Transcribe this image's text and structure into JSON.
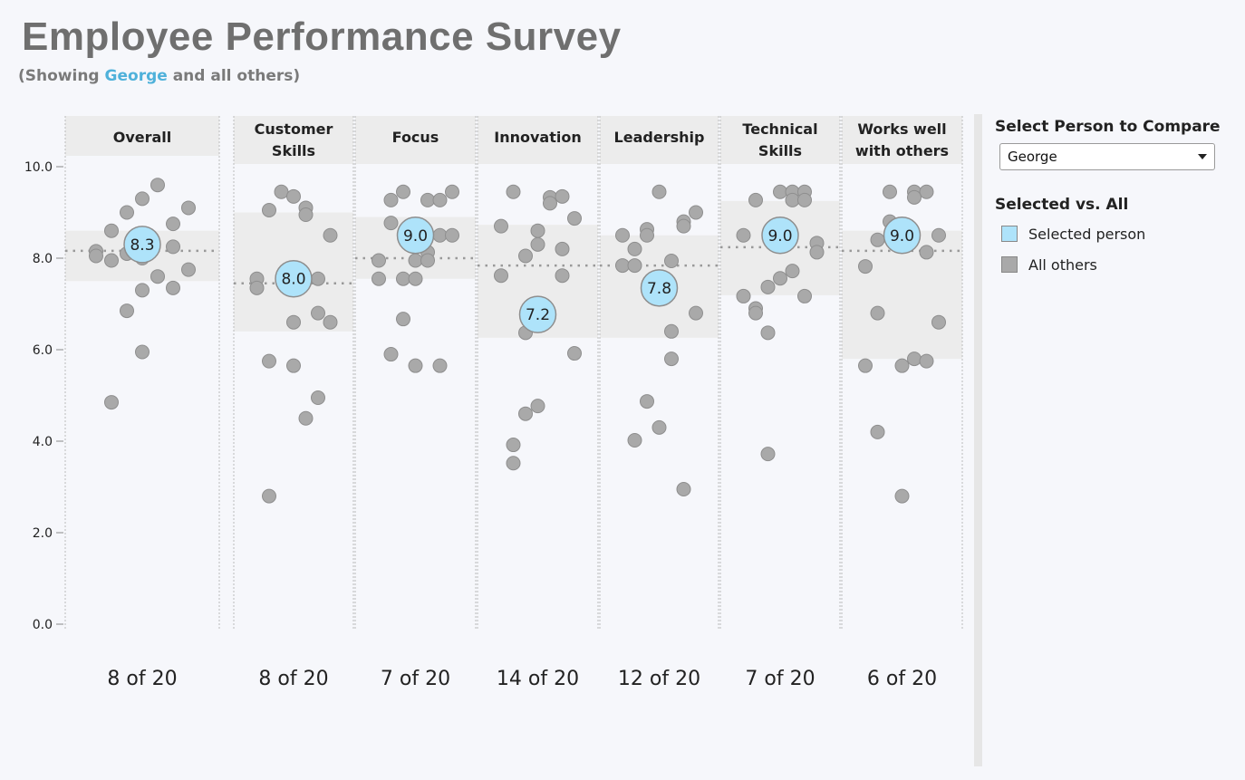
{
  "header": {
    "title": "Employee Performance Survey",
    "subtitle_prefix": "(Showing ",
    "subtitle_name": "George",
    "subtitle_suffix": " and all others)"
  },
  "panel": {
    "select_label": "Select Person to Compare",
    "selected_value": "George",
    "legend_title": "Selected vs. All",
    "legend": [
      {
        "label": "Selected person",
        "color": "#aee3fa"
      },
      {
        "label": "All others",
        "color": "#a9a9a9"
      }
    ]
  },
  "colors": {
    "selected": "#aee3fa",
    "others": "#a9a9a9",
    "band": "#ececec",
    "accent": "#4fb1da"
  },
  "chart_data": {
    "type": "scatter",
    "ylim": [
      0,
      10
    ],
    "yticks": [
      "0.0",
      "2.0",
      "4.0",
      "6.0",
      "8.0",
      "10.0"
    ],
    "grid": false,
    "legend_placement": "right",
    "categories": [
      {
        "name": "Overall",
        "selected": 8.3,
        "rank": "8 of 20",
        "median": 8.16,
        "band": [
          7.5,
          8.6
        ],
        "others": [
          8.15,
          8.05,
          8.6,
          7.95,
          9.0,
          8.1,
          9.3,
          9.6,
          8.75,
          8.25,
          9.1,
          7.75,
          7.6,
          7.35,
          7.3,
          6.85,
          5.95,
          4.85,
          8.0
        ]
      },
      {
        "name": "Customer Skills",
        "selected": 8.0,
        "rank": "8 of 20",
        "median": 7.45,
        "band": [
          6.4,
          9.0
        ],
        "others": [
          7.55,
          7.35,
          9.05,
          9.45,
          9.35,
          9.1,
          8.95,
          8.5,
          7.55,
          6.8,
          6.6,
          6.6,
          5.75,
          5.65,
          4.95,
          4.5,
          2.8
        ]
      },
      {
        "name": "Focus",
        "selected": 9.0,
        "rank": "7 of 20",
        "median": 8.0,
        "band": [
          7.55,
          8.9
        ],
        "others": [
          9.27,
          9.45,
          9.27,
          9.27,
          9.45,
          8.77,
          8.5,
          8.5,
          8.13,
          7.95,
          7.95,
          7.95,
          7.55,
          7.55,
          7.55,
          6.67,
          5.9,
          5.65,
          5.65
        ]
      },
      {
        "name": "Innovation",
        "selected": 7.2,
        "rank": "14 of 20",
        "median": 7.84,
        "band": [
          6.26,
          8.73
        ],
        "others": [
          9.45,
          9.33,
          9.2,
          9.35,
          8.87,
          8.7,
          8.6,
          8.3,
          8.2,
          8.05,
          7.62,
          7.62,
          6.37,
          5.92,
          4.77,
          4.6,
          3.92,
          3.52
        ]
      },
      {
        "name": "Leadership",
        "selected": 7.8,
        "rank": "12 of 20",
        "median": 7.84,
        "band": [
          6.26,
          8.5
        ],
        "others": [
          8.5,
          8.63,
          8.5,
          8.2,
          7.84,
          7.84,
          9.45,
          8.8,
          8.7,
          9.0,
          7.94,
          6.8,
          6.4,
          5.8,
          4.87,
          4.3,
          4.02,
          2.95
        ]
      },
      {
        "name": "Technical Skills",
        "selected": 9.0,
        "rank": "7 of 20",
        "median": 8.24,
        "band": [
          7.19,
          9.25
        ],
        "others": [
          9.27,
          9.45,
          9.45,
          9.45,
          9.27,
          9.27,
          8.5,
          8.33,
          8.13,
          7.72,
          7.56,
          7.37,
          7.17,
          7.17,
          6.9,
          6.8,
          6.37,
          3.72
        ]
      },
      {
        "name": "Works well with others",
        "selected": 9.0,
        "rank": "6 of 20",
        "median": 8.16,
        "band": [
          5.8,
          8.6
        ],
        "others": [
          9.45,
          9.45,
          9.45,
          9.33,
          8.8,
          8.4,
          8.5,
          8.13,
          7.82,
          6.8,
          6.6,
          5.65,
          5.65,
          5.8,
          5.75,
          4.2,
          2.8
        ]
      }
    ]
  }
}
